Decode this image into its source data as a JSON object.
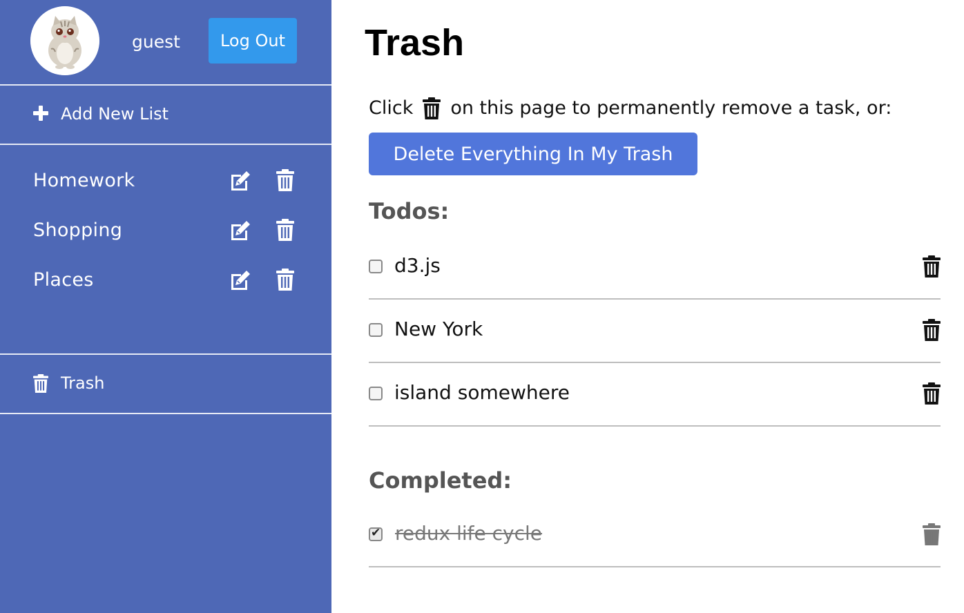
{
  "user": {
    "name": "guest",
    "logout_label": "Log Out"
  },
  "sidebar": {
    "add_list_label": "Add New List",
    "lists": [
      {
        "label": "Homework"
      },
      {
        "label": "Shopping"
      },
      {
        "label": "Places"
      }
    ],
    "trash_label": "Trash",
    "bg_color": "#4e68b6"
  },
  "main": {
    "title": "Trash",
    "instruction_before": "Click",
    "instruction_after": "on this page to permanently remove a task, or:",
    "delete_all_label": "Delete Everything In My Trash",
    "todos_heading": "Todos:",
    "todos": [
      {
        "text": "d3.js",
        "checked": false
      },
      {
        "text": "New York",
        "checked": false
      },
      {
        "text": "island somewhere",
        "checked": false
      }
    ],
    "completed_heading": "Completed:",
    "completed": [
      {
        "text": "redux life cycle",
        "checked": true
      }
    ]
  },
  "icons": {
    "avatar": "cat-avatar-icon",
    "add": "plus-icon",
    "edit": "edit-icon",
    "delete": "trash-icon"
  },
  "colors": {
    "logout_button": "#3399ec",
    "delete_all_button": "#5176db"
  }
}
